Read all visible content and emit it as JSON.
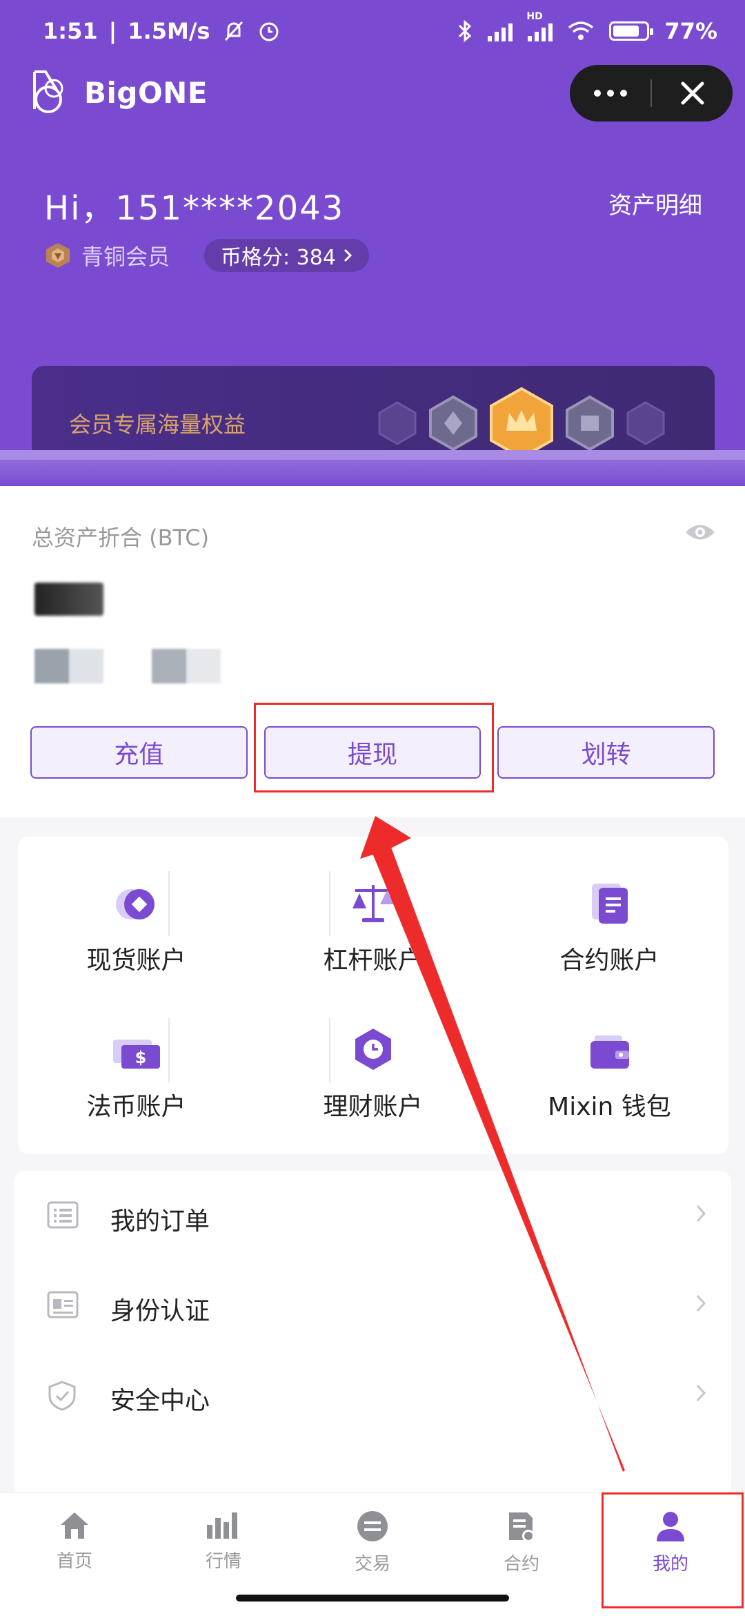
{
  "status_bar": {
    "time": "1:51",
    "speed": "1.5M/s",
    "hd_label": "HD",
    "battery": "77%"
  },
  "brand": {
    "name": "BigONE"
  },
  "profile": {
    "greeting": "Hi，151****2043",
    "asset_detail_link": "资产明细",
    "member_level": "青铜会员",
    "score_label": "币格分: 384",
    "benefit_banner": "会员专属海量权益"
  },
  "assets": {
    "total_label": "总资产折合 (BTC)",
    "actions": [
      "充值",
      "提现",
      "划转"
    ]
  },
  "accounts": [
    {
      "label": "现货账户",
      "icon": "spot-icon"
    },
    {
      "label": "杠杆账户",
      "icon": "scale-icon"
    },
    {
      "label": "合约账户",
      "icon": "contract-icon"
    },
    {
      "label": "法币账户",
      "icon": "fiat-icon"
    },
    {
      "label": "理财账户",
      "icon": "clock-icon"
    },
    {
      "label": "Mixin 钱包",
      "icon": "wallet-icon"
    }
  ],
  "menu": [
    {
      "label": "我的订单",
      "icon": "list-icon"
    },
    {
      "label": "身份认证",
      "icon": "id-card-icon"
    },
    {
      "label": "安全中心",
      "icon": "shield-icon"
    }
  ],
  "tabs": [
    {
      "label": "首页",
      "icon": "home-icon"
    },
    {
      "label": "行情",
      "icon": "chart-icon"
    },
    {
      "label": "交易",
      "icon": "exchange-icon"
    },
    {
      "label": "合约",
      "icon": "contract-tab-icon"
    },
    {
      "label": "我的",
      "icon": "user-icon",
      "active": true
    }
  ],
  "colors": {
    "brand_purple": "#7a4bd1",
    "annotation_red": "#ee2b2b",
    "gold": "#f0a43a"
  }
}
